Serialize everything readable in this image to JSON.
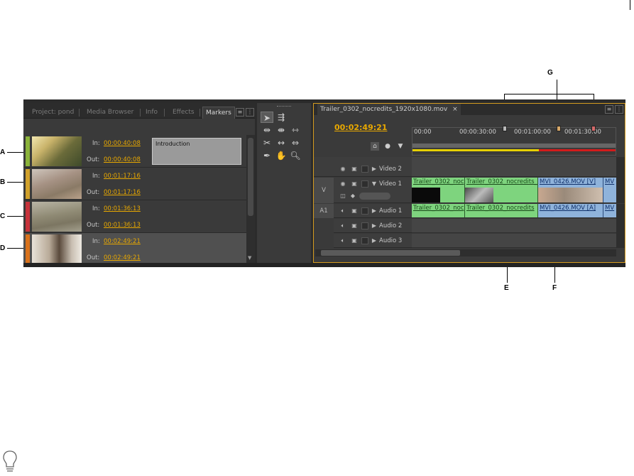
{
  "callouts": {
    "A": "A",
    "B": "B",
    "C": "C",
    "D": "D",
    "E": "E",
    "F": "F",
    "G": "G"
  },
  "left_tabs": [
    {
      "label": "Project: pond"
    },
    {
      "label": "Media Browser"
    },
    {
      "label": "Info"
    },
    {
      "label": "Effects"
    },
    {
      "label": "Markers"
    }
  ],
  "markers": [
    {
      "color": "#8bb33a",
      "in_label": "In:",
      "in": "00:00:40:08",
      "out_label": "Out:",
      "out": "00:00:40:08",
      "comment": "Introduction",
      "selected": false
    },
    {
      "color": "#d1a12b",
      "in_label": "In:",
      "in": "00:01:17:16",
      "out_label": "Out:",
      "out": "00:01:17:16",
      "comment": "",
      "selected": false
    },
    {
      "color": "#c7333b",
      "in_label": "In:",
      "in": "00:01:36:13",
      "out_label": "Out:",
      "out": "00:01:36:13",
      "comment": "",
      "selected": false
    },
    {
      "color": "#d9721c",
      "in_label": "In:",
      "in": "00:02:49:21",
      "out_label": "Out:",
      "out": "00:02:49:21",
      "comment": "",
      "selected": true
    }
  ],
  "timeline": {
    "tab_title": "Trailer_0302_nocredits_1920x1080.mov",
    "close_symbol": "×",
    "playhead": "00:02:49:21",
    "ruler_labels": [
      "00:00",
      "00:00:30:00",
      "00:01:00:00",
      "00:01:30:00"
    ],
    "tracks": {
      "video2": "Video 2",
      "video1": "Video 1",
      "video1_patch": "V",
      "audio1": "Audio 1",
      "audio1_patch": "A1",
      "audio2": "Audio 2",
      "audio3": "Audio 3"
    },
    "video_clips": [
      {
        "label": "Trailer_0302_noc",
        "color": "#7ed47e"
      },
      {
        "label": "Trailer_0302_nocredits_",
        "color": "#7ed47e"
      },
      {
        "label": "MVI_0426.MOV [V]",
        "color": "#8fb3db"
      },
      {
        "label": "MV",
        "color": "#8fb3db"
      }
    ],
    "audio_clips": [
      {
        "label": "Trailer_0302_noc",
        "color": "#7ed47e"
      },
      {
        "label": "Trailer_0302_nocredits",
        "color": "#7ed47e"
      },
      {
        "label": "MVI_0426.MOV [A]",
        "color": "#8fb3db"
      },
      {
        "label": "MV",
        "color": "#8fb3db"
      }
    ]
  },
  "colors": {
    "timecode": "#e8a800",
    "panel_focus": "#d59c1f",
    "render_yellow": "#e6d000",
    "render_red": "#d21b1b"
  }
}
